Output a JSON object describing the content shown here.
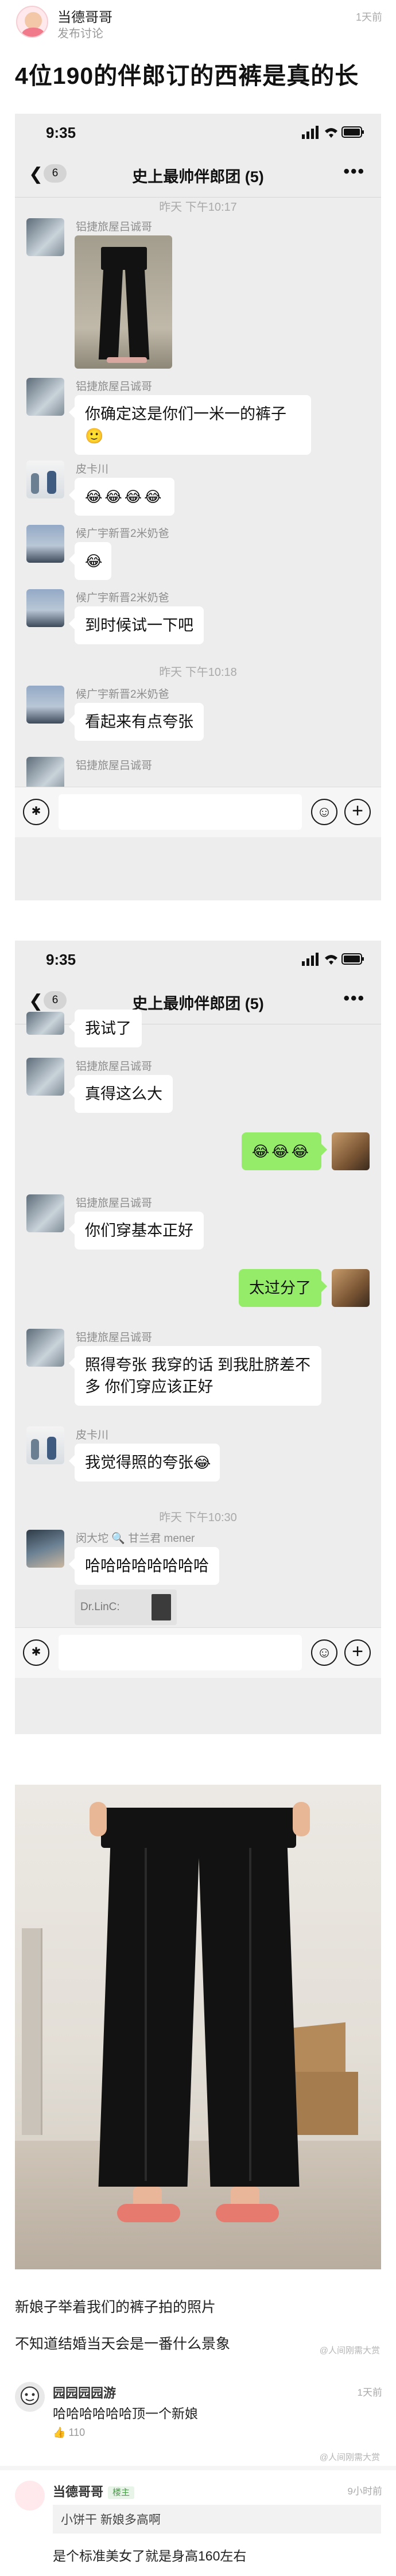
{
  "post": {
    "author": "当德哥哥",
    "subtitle": "发布讨论",
    "time": "1天前",
    "title": "4位190的伴郎订的西裤是真的长"
  },
  "screen1": {
    "clock": "9:35",
    "back_count": "6",
    "chat_title": "史上最帅伴郎团 (5)",
    "more": "•••",
    "timestamps": [
      "昨天 下午10:17",
      "昨天 下午10:18"
    ],
    "messages": [
      {
        "sender": "铝捷旅屋吕诚哥",
        "type": "image"
      },
      {
        "sender": "铝捷旅屋吕诚哥",
        "text": "你确定这是你们一米一的裤子",
        "emoji": "🙂"
      },
      {
        "sender": "皮卡川",
        "emoji": "😂😂😂😂"
      },
      {
        "sender": "候广宇新晋2米奶爸",
        "emoji": "😂"
      },
      {
        "sender": "候广宇新晋2米奶爸",
        "text": "到时候试一下吧"
      },
      {
        "sender": "候广宇新晋2米奶爸",
        "text": "看起来有点夸张"
      },
      {
        "sender": "铝捷旅屋吕诚哥"
      }
    ]
  },
  "screen2": {
    "clock": "9:35",
    "back_count": "6",
    "chat_title": "史上最帅伴郎团 (5)",
    "more": "•••",
    "timestamp": "昨天 下午10:30",
    "messages": [
      {
        "text": "我试了"
      },
      {
        "sender": "铝捷旅屋吕诚哥",
        "text": "真得这么大"
      },
      {
        "side": "right",
        "emoji": "😂😂😂"
      },
      {
        "sender": "铝捷旅屋吕诚哥",
        "text": "你们穿基本正好"
      },
      {
        "side": "right",
        "text": "太过分了"
      },
      {
        "sender": "铝捷旅屋吕诚哥",
        "text": "照得夸张 我穿的话 到我肚脐差不多 你们穿应该正好"
      },
      {
        "sender": "皮卡川",
        "text": "我觉得照的夸张",
        "emoji": "😂"
      },
      {
        "sender": "闵大坨 🔍 甘兰君 mener",
        "text": "哈哈哈哈哈哈哈哈",
        "quote": "Dr.LinC:"
      }
    ]
  },
  "captions": [
    "新娘子举着我们的裤子拍的照片",
    "不知道结婚当天会是一番什么景象"
  ],
  "watermark": "@人间刚需大赏",
  "comments": [
    {
      "name": "园园园园游",
      "time": "1天前",
      "text": "哈哈哈哈哈哈顶一个新娘",
      "likes": "110"
    },
    {
      "name": "当德哥哥",
      "tag": "楼主",
      "time": "9小时前",
      "reply_name": "小饼干",
      "reply_text": "新娘多高啊",
      "text": "是个标准美女了就是身高160左右"
    }
  ]
}
